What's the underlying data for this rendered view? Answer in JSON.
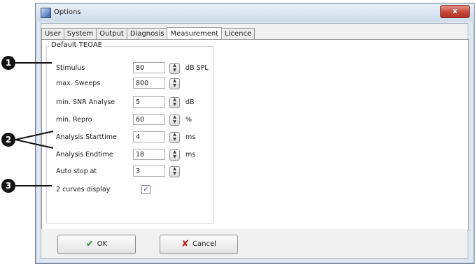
{
  "window": {
    "title": "Options",
    "close_label": "x"
  },
  "tabs": [
    "User",
    "System",
    "Output",
    "Diagnosis",
    "Measurement",
    "Licence"
  ],
  "group": {
    "title": "Default TEOAE"
  },
  "rows": [
    {
      "label": "Stimulus",
      "value": "80",
      "unit": "dB SPL"
    },
    {
      "label": "max. Sweeps",
      "value": "800",
      "unit": ""
    },
    {
      "label": "min. SNR Analyse",
      "value": "5",
      "unit": "dB"
    },
    {
      "label": "min. Repro",
      "value": "60",
      "unit": "%"
    },
    {
      "label": "Analysis Starttime",
      "value": "4",
      "unit": "ms"
    },
    {
      "label": "Analysis Endtime",
      "value": "18",
      "unit": "ms"
    },
    {
      "label": "Auto stop at",
      "value": "3",
      "unit": ""
    }
  ],
  "checkbox": {
    "label": "2 curves display",
    "checked": true,
    "mark": "✓"
  },
  "buttons": {
    "ok": "OK",
    "cancel": "Cancel",
    "ok_glyph": "✔",
    "cancel_glyph": "✘"
  },
  "callouts": [
    "1",
    "2",
    "3"
  ],
  "icons": {
    "spin_up": "▲",
    "spin_down": "▼"
  }
}
